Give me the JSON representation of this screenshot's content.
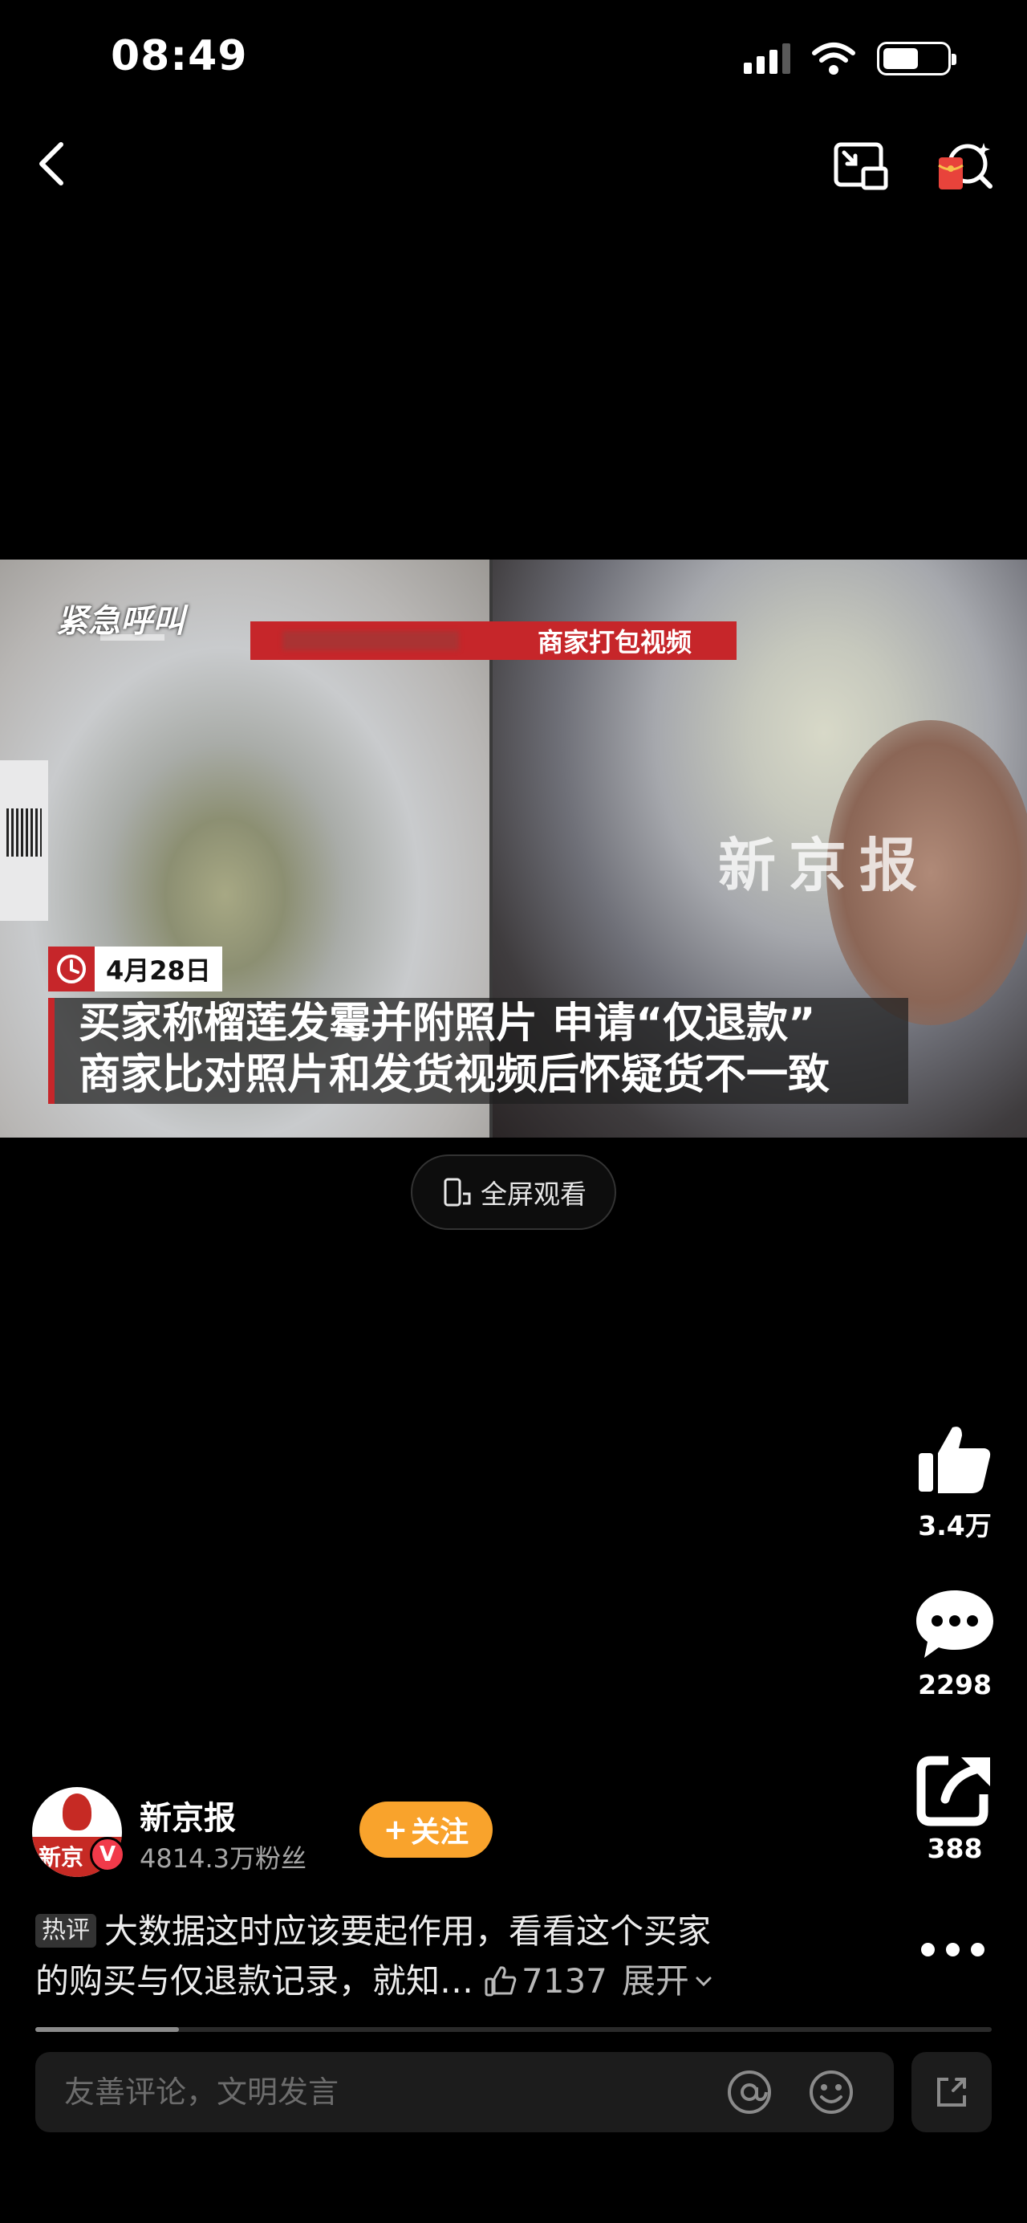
{
  "status_bar": {
    "time": "08:49"
  },
  "video": {
    "top_banner": "商家打包视频",
    "watermark": "新京报",
    "date_tag": "4月28日",
    "caption_lines": [
      "买家称榴莲发霉并附照片 申请“仅退款”",
      "商家比对照片和发货视频后怀疑货不一致"
    ]
  },
  "fullscreen_label": "全屏观看",
  "actions": {
    "likes": "3.4万",
    "comments": "2298",
    "shares": "388"
  },
  "author": {
    "name": "新京报",
    "fans": "4814.3万粉丝",
    "follow_label": "关注",
    "avatar_text": "新京",
    "verified_mark": "V"
  },
  "hot_comment": {
    "badge": "热评",
    "line1": "大数据这时应该要起作用，看看这个买家",
    "line2": "的购买与仅退款记录，就知…",
    "likes": "7137",
    "expand_label": "展开"
  },
  "progress": {
    "value": 0.15
  },
  "comment_input": {
    "placeholder": "友善评论，文明发言"
  },
  "colors": {
    "accent_red": "#c6262a",
    "follow_orange": "#f9a32c",
    "verified_red": "#f13a4a"
  },
  "icons": [
    "back-icon",
    "pip-icon",
    "search-redpacket-icon",
    "clock-icon",
    "phone-icon",
    "thumb-up-icon",
    "comment-icon",
    "share-icon",
    "more-icon",
    "at-icon",
    "emoji-icon",
    "expand-icon"
  ]
}
